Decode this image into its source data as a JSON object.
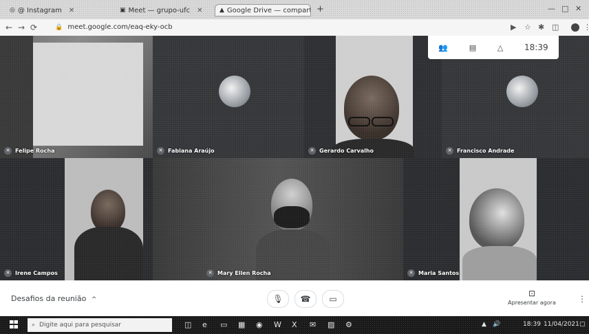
{
  "browser": {
    "tabs": [
      {
        "label": "@ Instagram",
        "icon": "instagram-icon"
      },
      {
        "label": "Meet — grupo-ufc",
        "icon": "meet-icon"
      },
      {
        "label": "Google Drive — compartilhado",
        "icon": "drive-icon"
      }
    ],
    "new_tab": "+",
    "url": "meet.google.com/eaq-eky-ocb"
  },
  "meet": {
    "clock": "18:39",
    "participants": [
      {
        "name": "Felipe Rocha"
      },
      {
        "name": "Fabiana Araújo"
      },
      {
        "name": "Gerardo Carvalho"
      },
      {
        "name": "Francisco Andrade"
      },
      {
        "name": "Irene Campos"
      },
      {
        "name": "Mary Ellen Rocha"
      },
      {
        "name": "Maria Santos"
      }
    ],
    "meeting_title": "Desafios da reunião",
    "present_label": "Apresentar agora"
  },
  "taskbar": {
    "search_placeholder": "Digite aqui para pesquisar",
    "time": "18:39",
    "date": "11/04/2021"
  }
}
